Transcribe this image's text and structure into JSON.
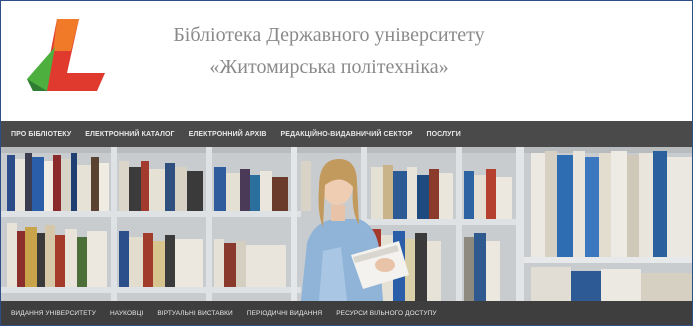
{
  "header": {
    "title_line1": "Бібліотека Державного університету",
    "title_line2": "«Житомирська політехніка»"
  },
  "nav_top": [
    "ПРО БІБЛІОТЕКУ",
    "ЕЛЕКТРОННИЙ КАТАЛОГ",
    "ЕЛЕКТРОННИЙ АРХІВ",
    "РЕДАКЦІЙНО-ВИДАВНИЧИЙ СЕКТОР",
    "ПОСЛУГИ"
  ],
  "nav_bottom": [
    "ВИДАННЯ УНІВЕРСИТЕТУ",
    "НАУКОВЦІ",
    "ВІРТУАЛЬНІ ВИСТАВКИ",
    "ПЕРІОДИЧНІ ВИДАННЯ",
    "РЕСУРСИ ВІЛЬНОГО ДОСТУПУ"
  ],
  "colors": {
    "logo_red": "#e03a2f",
    "logo_orange": "#f07a28",
    "logo_green": "#4caf3e",
    "nav_bg": "#4a4a4a",
    "border": "#2d4f86"
  },
  "banner": {
    "icon": "bookshelf-photo"
  }
}
